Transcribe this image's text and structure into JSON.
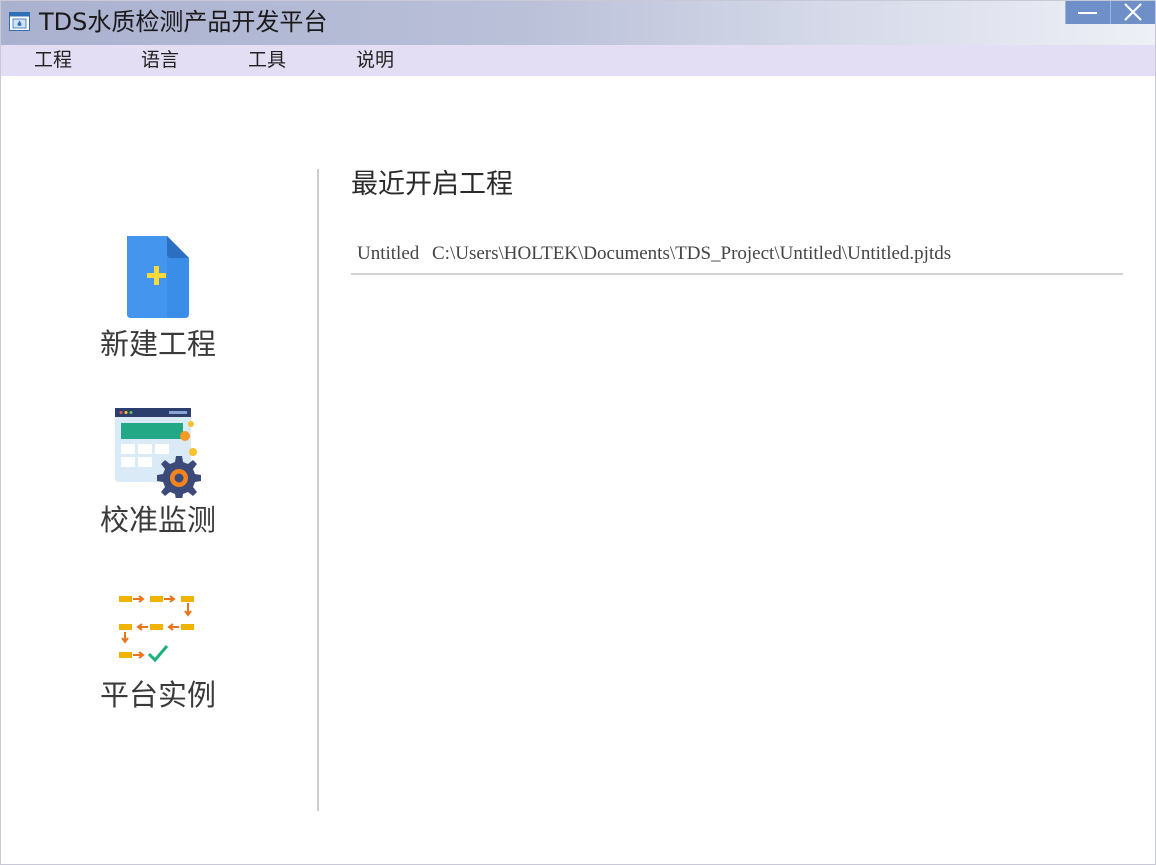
{
  "window": {
    "title": "TDS水质检测产品开发平台",
    "app_icon": "app-window-icon",
    "buttons": {
      "minimize": "minimize-icon",
      "close": "close-icon"
    },
    "titlebar_color_start": "#aab1cf",
    "titlebar_color_end": "#eef0f6",
    "button_color": "#6f8fc9"
  },
  "menu": {
    "items": [
      {
        "label": "工程"
      },
      {
        "label": "语言"
      },
      {
        "label": "工具"
      },
      {
        "label": "说明"
      }
    ],
    "background": "#e3def3"
  },
  "sidebar": {
    "actions": [
      {
        "label": "新建工程",
        "icon": "new-file-icon"
      },
      {
        "label": "校准监测",
        "icon": "dashboard-settings-icon"
      },
      {
        "label": "平台实例",
        "icon": "workflow-icon"
      }
    ]
  },
  "recent": {
    "title": "最近开启工程",
    "projects": [
      {
        "name": "Untitled",
        "path": "C:\\Users\\HOLTEK\\Documents\\TDS_Project\\Untitled\\Untitled.pjtds"
      }
    ]
  }
}
